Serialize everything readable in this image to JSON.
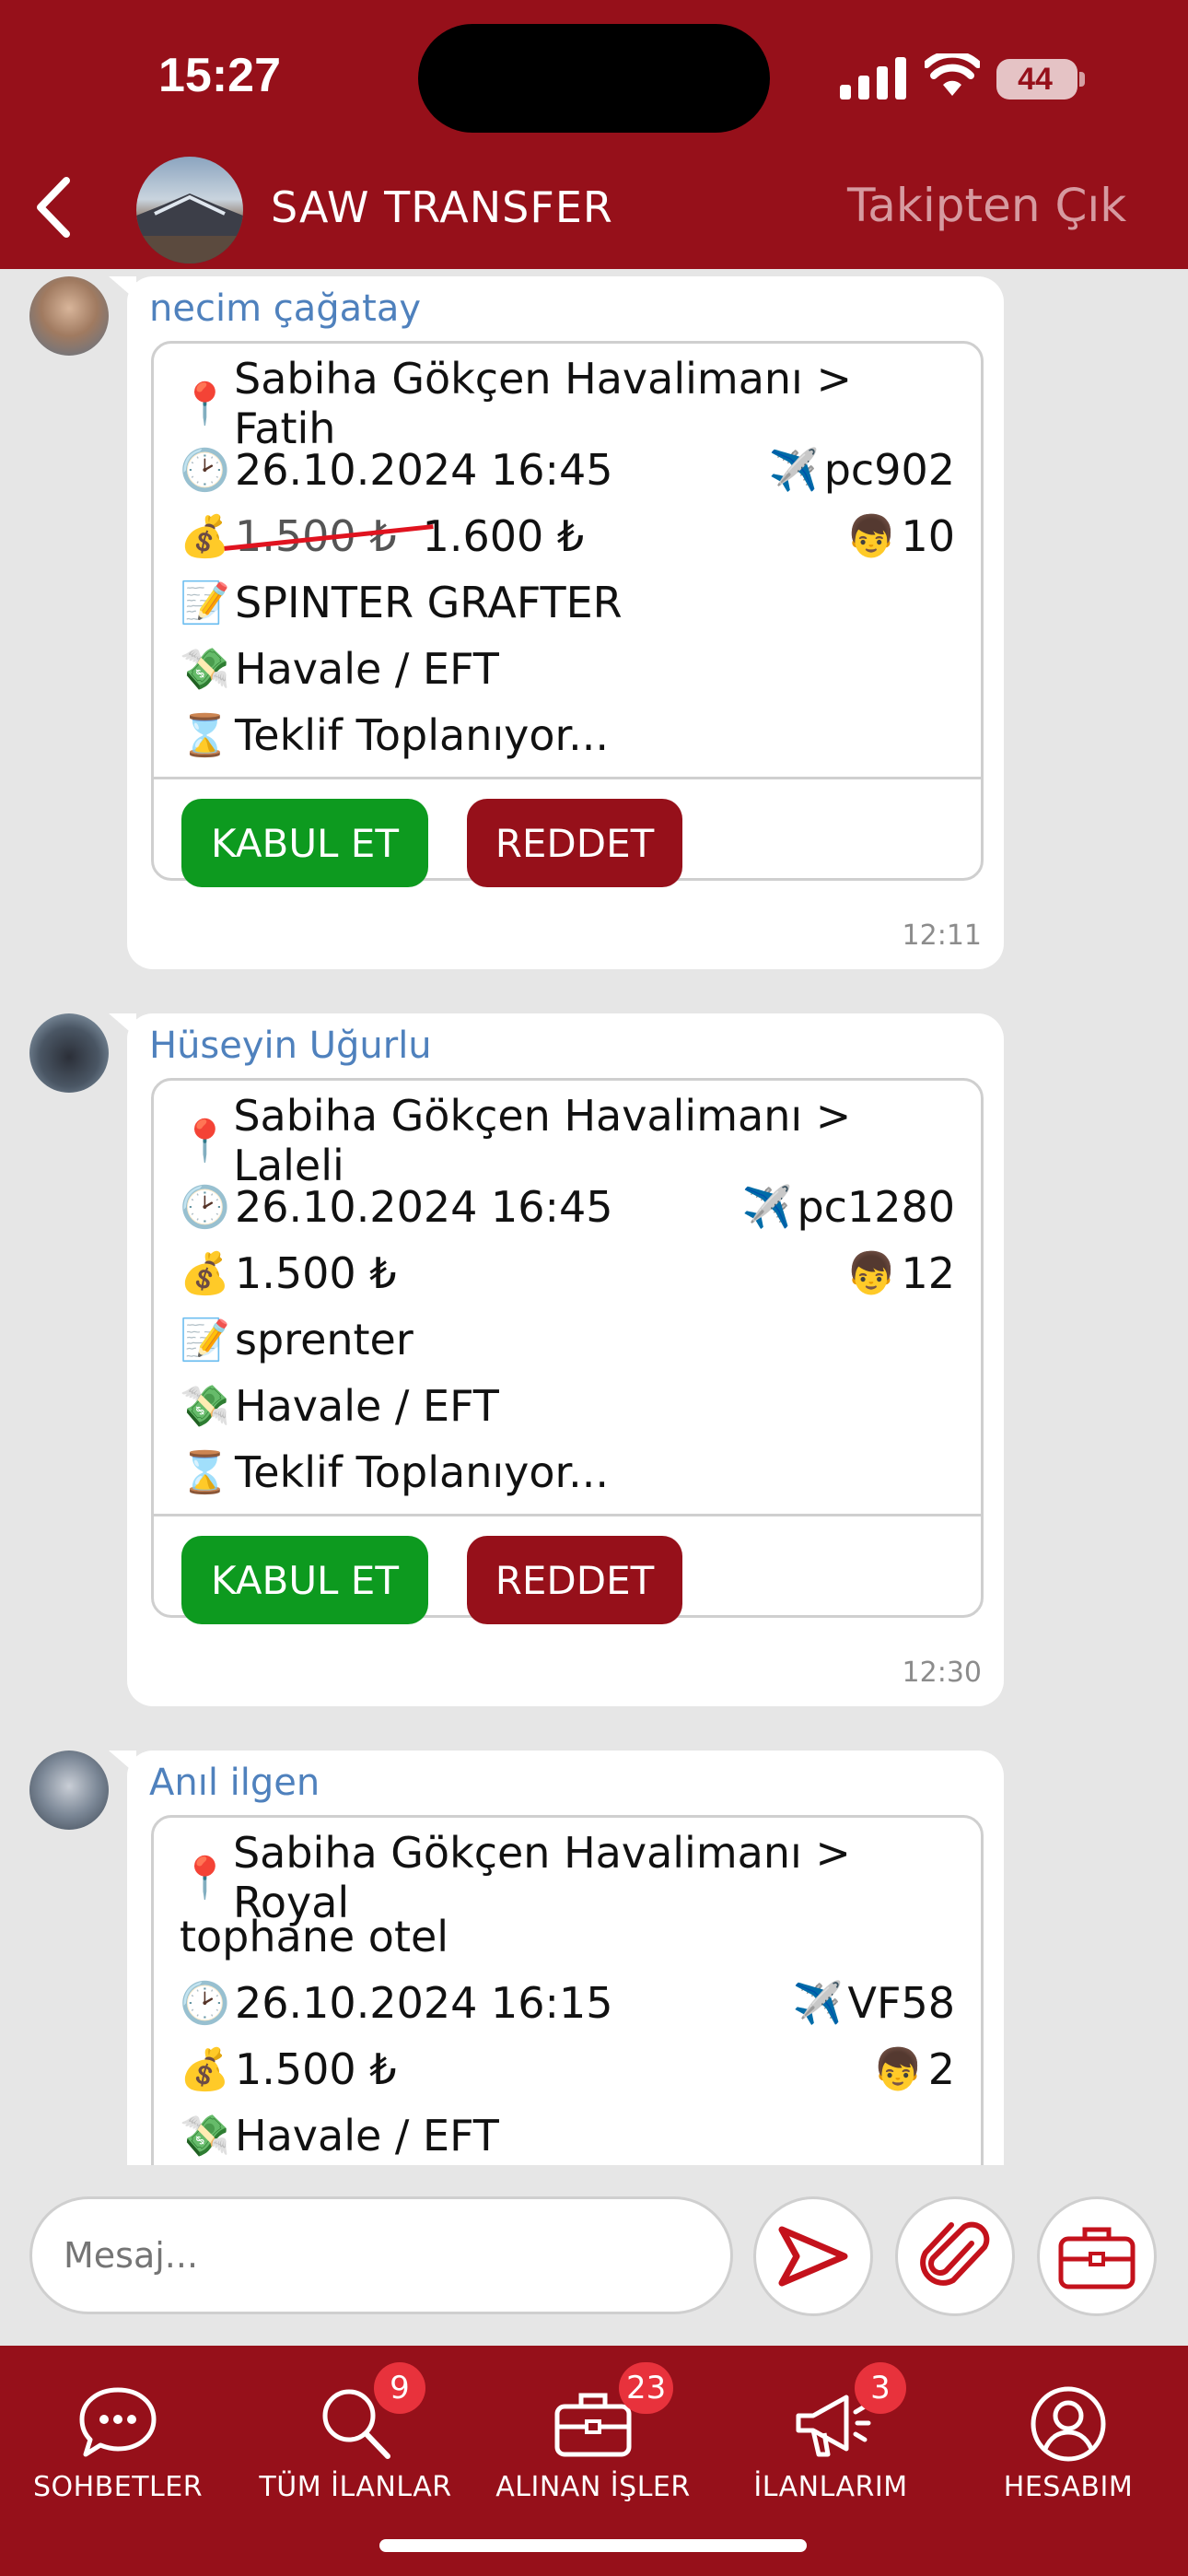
{
  "status_bar": {
    "time": "15:27",
    "battery": "44"
  },
  "header": {
    "title": "SAW TRANSFER",
    "unfollow": "Takipten Çık"
  },
  "messages": [
    {
      "sender": "necim çağatay",
      "route": "Sabiha Gökçen Havalimanı > Fatih",
      "datetime": "26.10.2024 16:45",
      "flight": "pc902",
      "old_price": "1.500 ₺",
      "price": "1.600 ₺",
      "passengers": "10",
      "note": "SPINTER GRAFTER",
      "payment": "Havale / EFT",
      "status": "Teklif Toplanıyor...",
      "accept": "KABUL ET",
      "reject": "REDDET",
      "time": "12:11"
    },
    {
      "sender": "Hüseyin Uğurlu",
      "route": "Sabiha Gökçen Havalimanı > Laleli",
      "datetime": "26.10.2024 16:45",
      "flight": "pc1280",
      "price": "1.500 ₺",
      "passengers": "12",
      "note": "sprenter",
      "payment": "Havale / EFT",
      "status": "Teklif Toplanıyor...",
      "accept": "KABUL ET",
      "reject": "REDDET",
      "time": "12:30"
    },
    {
      "sender": "Anıl ilgen",
      "route_line1": "Sabiha Gökçen Havalimanı > Royal",
      "route_line2": "tophane otel",
      "datetime": "26.10.2024 16:15",
      "flight": "VF58",
      "price": "1.500 ₺",
      "passengers": "2",
      "payment": "Havale / EFT"
    }
  ],
  "composer": {
    "placeholder": "Mesaj..."
  },
  "tabbar": [
    {
      "label": "SOHBETLER",
      "icon": "chat-bubble-icon"
    },
    {
      "label": "TÜM İLANLAR",
      "badge": "9",
      "icon": "search-icon"
    },
    {
      "label": "ALINAN İŞLER",
      "badge": "23",
      "icon": "briefcase-icon"
    },
    {
      "label": "İLANLARIM",
      "badge": "3",
      "icon": "megaphone-icon"
    },
    {
      "label": "HESABIM",
      "icon": "user-icon"
    }
  ],
  "emojis": {
    "pin": "📍",
    "clock": "🕑",
    "plane": "✈️",
    "money": "💰",
    "person": "👦",
    "memo": "📝",
    "cash": "💸",
    "hourglass": "⌛"
  },
  "colors": {
    "brand": "#96101a",
    "accept": "#0d9a1f",
    "badge": "#e8323c",
    "sender": "#4f81bd"
  }
}
